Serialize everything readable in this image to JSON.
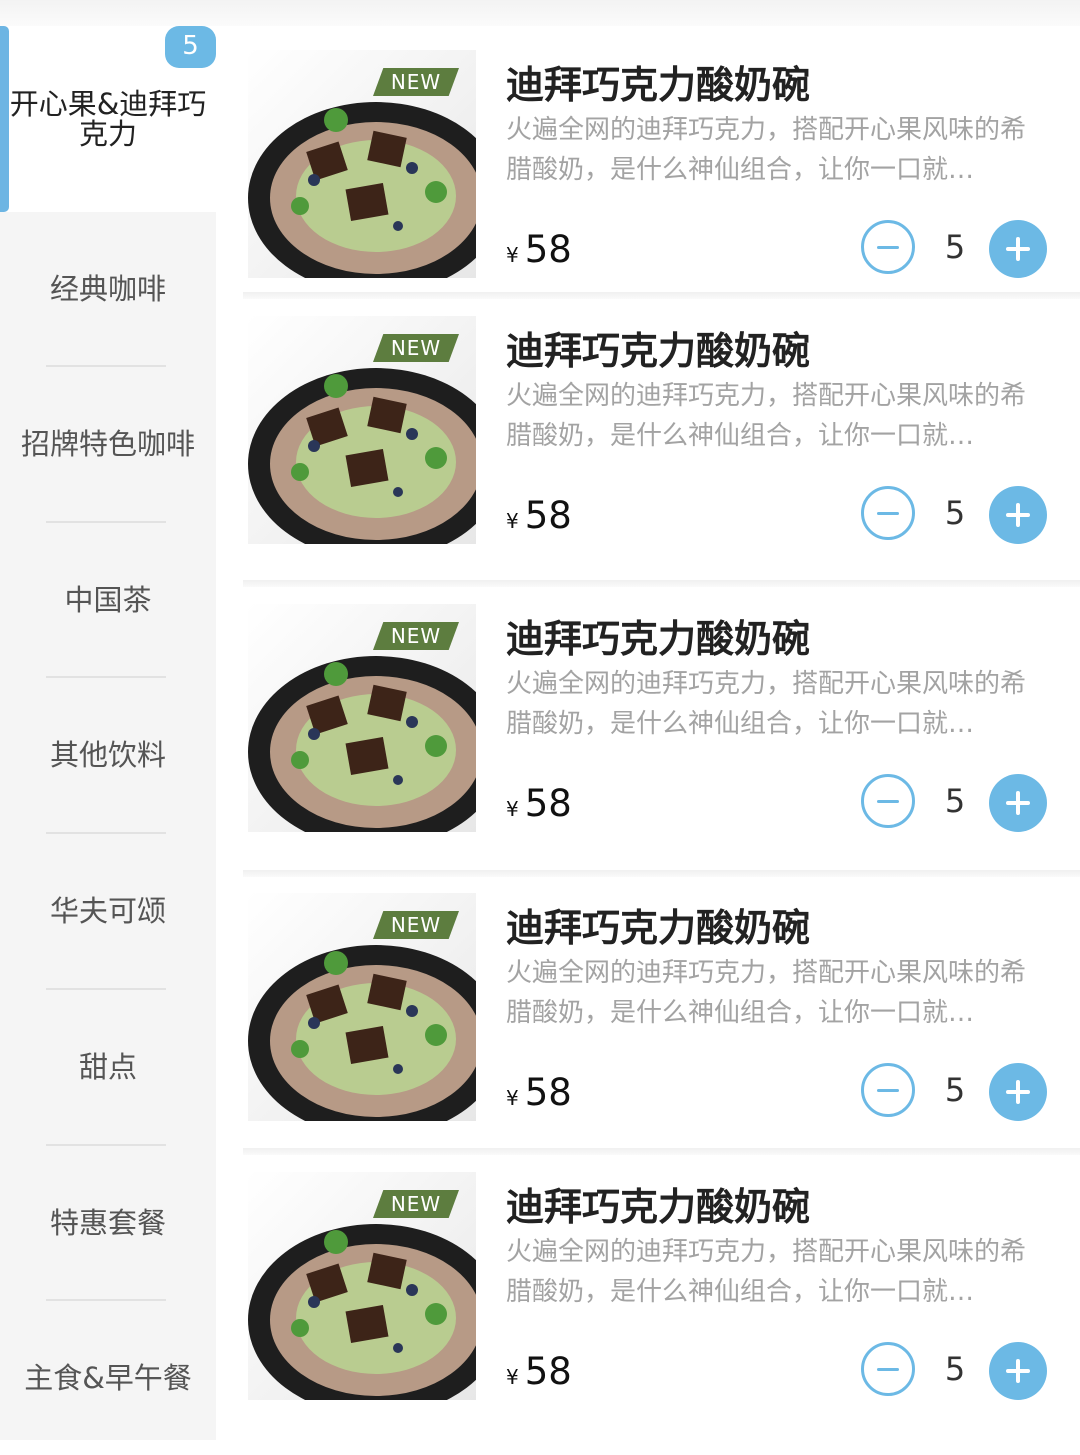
{
  "sidebar": {
    "badge": "5",
    "categories": [
      {
        "label": "开心果&迪拜巧克力"
      },
      {
        "label": "经典咖啡"
      },
      {
        "label": "招牌特色咖啡"
      },
      {
        "label": "中国茶"
      },
      {
        "label": "其他饮料"
      },
      {
        "label": "华夫可颂"
      },
      {
        "label": "甜点"
      },
      {
        "label": "特惠套餐"
      },
      {
        "label": "主食&早午餐"
      }
    ]
  },
  "products": [
    {
      "tag": "NEW",
      "name": "迪拜巧克力酸奶碗",
      "description": "火遍全网的迪拜巧克力，搭配开心果风味的希腊酸奶，是什么神仙组合，让你一口就…",
      "currency": "¥",
      "price": "58",
      "quantity": "5"
    },
    {
      "tag": "NEW",
      "name": "迪拜巧克力酸奶碗",
      "description": "火遍全网的迪拜巧克力，搭配开心果风味的希腊酸奶，是什么神仙组合，让你一口就…",
      "currency": "¥",
      "price": "58",
      "quantity": "5"
    },
    {
      "tag": "NEW",
      "name": "迪拜巧克力酸奶碗",
      "description": "火遍全网的迪拜巧克力，搭配开心果风味的希腊酸奶，是什么神仙组合，让你一口就…",
      "currency": "¥",
      "price": "58",
      "quantity": "5"
    },
    {
      "tag": "NEW",
      "name": "迪拜巧克力酸奶碗",
      "description": "火遍全网的迪拜巧克力，搭配开心果风味的希腊酸奶，是什么神仙组合，让你一口就…",
      "currency": "¥",
      "price": "58",
      "quantity": "5"
    },
    {
      "tag": "NEW",
      "name": "迪拜巧克力酸奶碗",
      "description": "火遍全网的迪拜巧克力，搭配开心果风味的希腊酸奶，是什么神仙组合，让你一口就…",
      "currency": "¥",
      "price": "58",
      "quantity": "5"
    }
  ],
  "icons": {
    "minus": "minus-circle-icon",
    "plus": "plus-circle-icon"
  },
  "colors": {
    "accent": "#6cb9e5",
    "new_tag": "#5d7d3f"
  }
}
